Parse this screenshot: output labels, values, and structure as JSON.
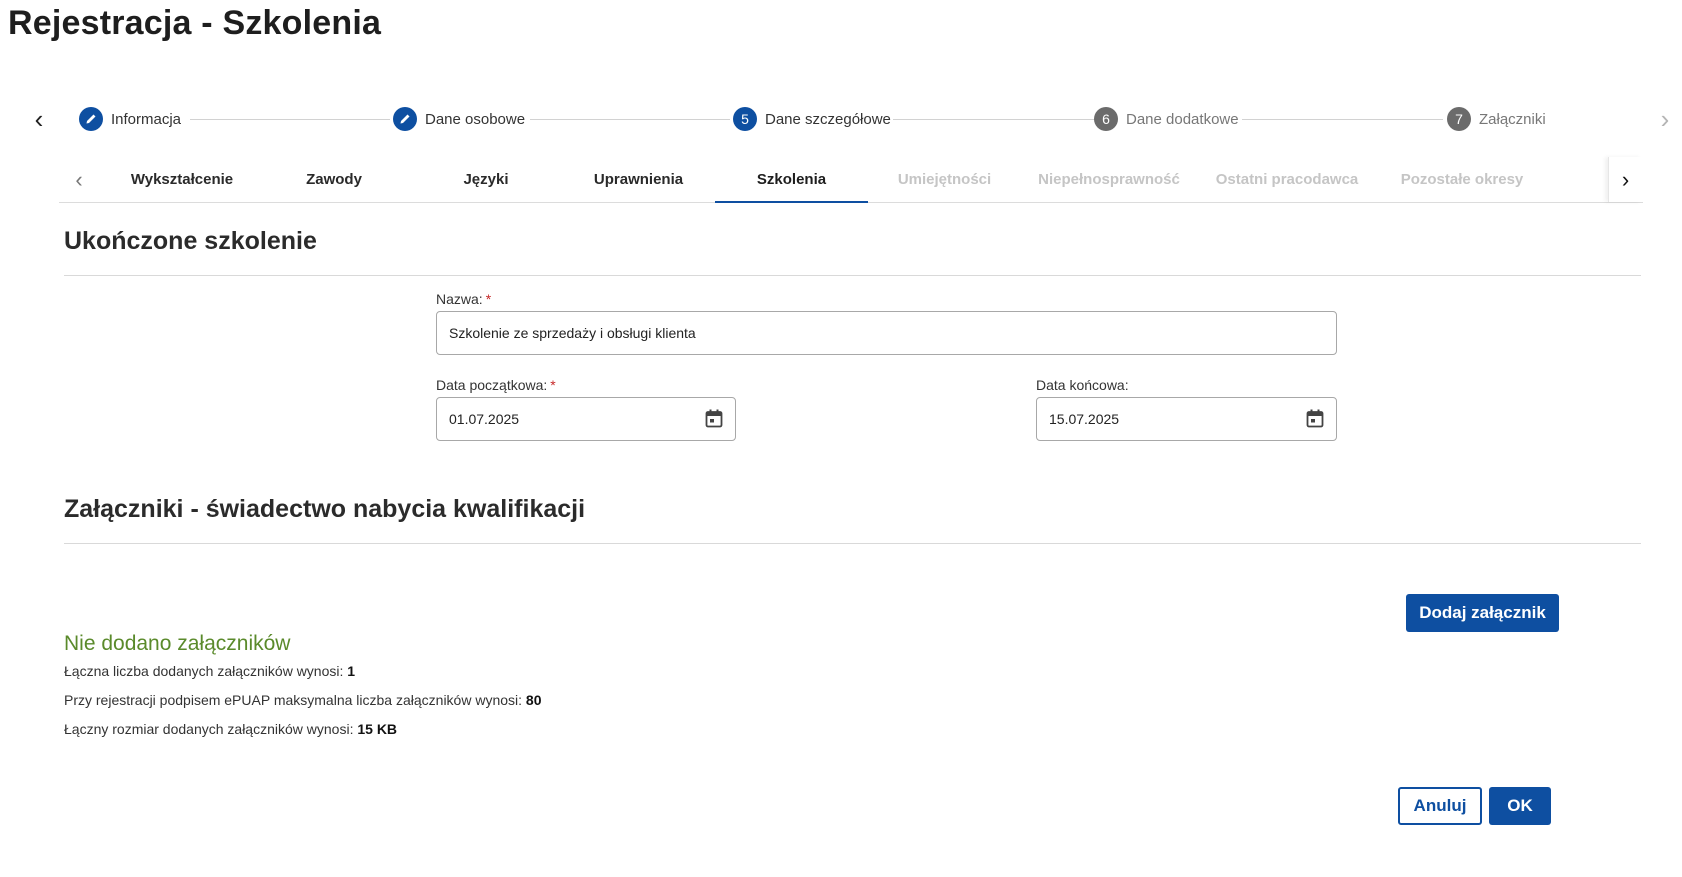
{
  "page": {
    "title": "Rejestracja - Szkolenia"
  },
  "stepper": {
    "steps": [
      {
        "label": "Informacja",
        "state": "done",
        "number": ""
      },
      {
        "label": "Dane osobowe",
        "state": "done",
        "number": ""
      },
      {
        "label": "Dane szczegółowe",
        "state": "active",
        "number": "5"
      },
      {
        "label": "Dane dodatkowe",
        "state": "pending",
        "number": "6"
      },
      {
        "label": "Załączniki",
        "state": "pending",
        "number": "7"
      }
    ]
  },
  "tabs": [
    {
      "label": "Wykształcenie",
      "state": "normal"
    },
    {
      "label": "Zawody",
      "state": "normal"
    },
    {
      "label": "Języki",
      "state": "normal"
    },
    {
      "label": "Uprawnienia",
      "state": "normal"
    },
    {
      "label": "Szkolenia",
      "state": "active"
    },
    {
      "label": "Umiejętności",
      "state": "disabled"
    },
    {
      "label": "Niepełnosprawność",
      "state": "disabled"
    },
    {
      "label": "Ostatni pracodawca",
      "state": "disabled"
    },
    {
      "label": "Pozostałe okresy",
      "state": "disabled"
    }
  ],
  "training": {
    "section_title": "Ukończone szkolenie",
    "name_label": "Nazwa:",
    "name_value": "Szkolenie ze sprzedaży i obsługi klienta",
    "start_label": "Data początkowa:",
    "start_value": "01.07.2025",
    "end_label": "Data końcowa:",
    "end_value": "15.07.2025",
    "required_mark": "*"
  },
  "attachments": {
    "section_title": "Załączniki - świadectwo nabycia kwalifikacji",
    "empty_message": "Nie dodano załączników",
    "add_button": "Dodaj załącznik",
    "info": {
      "count_label": "Łączna liczba dodanych załączników wynosi:",
      "count_value": "1",
      "max_label": "Przy rejestracji podpisem ePUAP maksymalna liczba załączników wynosi:",
      "max_value": "80",
      "size_label": "Łączny rozmiar dodanych załączników wynosi:",
      "size_value": "15 KB"
    }
  },
  "footer": {
    "cancel_label": "Anuluj",
    "ok_label": "OK"
  },
  "colors": {
    "primary": "#0e4fa1",
    "success_text": "#5a8a2b",
    "required": "#c62828"
  }
}
